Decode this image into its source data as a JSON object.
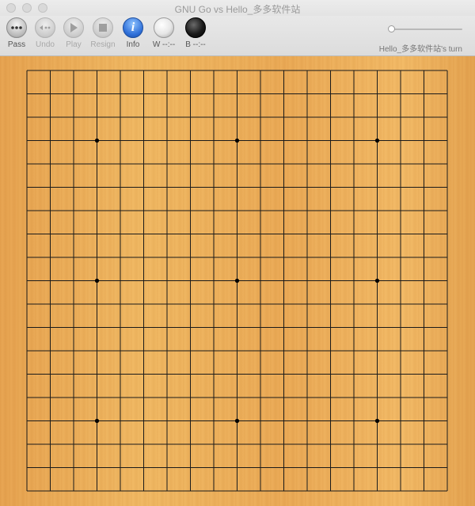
{
  "window": {
    "title": "GNU Go vs Hello_多多软件站"
  },
  "toolbar": {
    "pass": "Pass",
    "undo": "Undo",
    "play": "Play",
    "resign": "Resign",
    "info": "Info",
    "white_clock": "W --:--",
    "black_clock": "B --:--",
    "info_glyph": "i"
  },
  "status": {
    "turn": "Hello_多多软件站's turn"
  },
  "board": {
    "size": 19,
    "star_points": [
      [
        3,
        3
      ],
      [
        3,
        9
      ],
      [
        3,
        15
      ],
      [
        9,
        3
      ],
      [
        9,
        9
      ],
      [
        9,
        15
      ],
      [
        15,
        3
      ],
      [
        15,
        9
      ],
      [
        15,
        15
      ]
    ],
    "line_color": "#1a1a1a",
    "wood_color": "#eeb05e"
  }
}
